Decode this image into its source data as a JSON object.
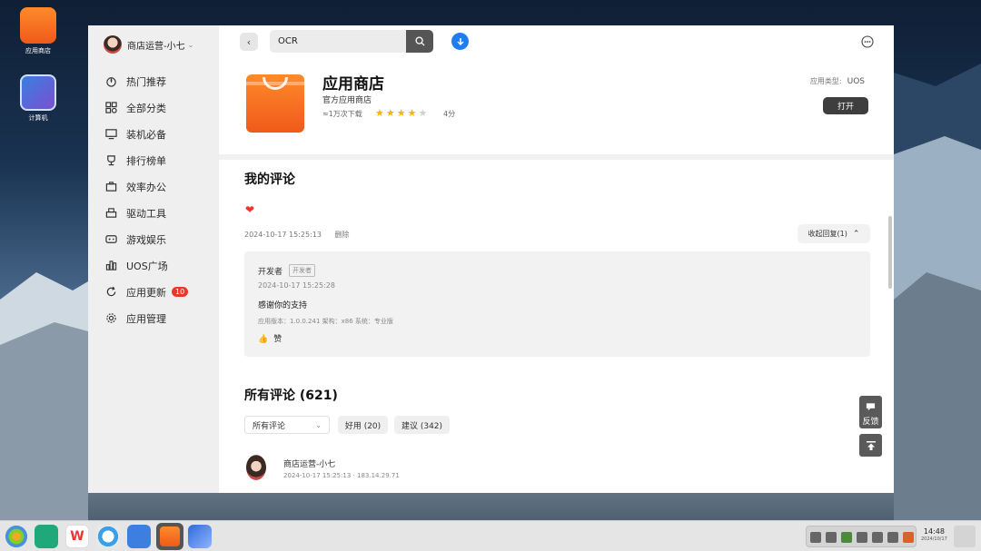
{
  "desktop": {
    "icons": [
      {
        "label": "应用商店",
        "icon": "app-store-icon"
      },
      {
        "label": "计算机",
        "icon": "computer-icon"
      }
    ]
  },
  "sidebar": {
    "user": {
      "name": "商店运营-小七",
      "icon": "user-avatar",
      "caret": "⌄"
    },
    "items": [
      {
        "label": "热门推荐",
        "icon": "fire-icon"
      },
      {
        "label": "全部分类",
        "icon": "grid-icon"
      },
      {
        "label": "装机必备",
        "icon": "monitor-icon"
      },
      {
        "label": "排行榜单",
        "icon": "trophy-icon"
      },
      {
        "label": "效率办公",
        "icon": "briefcase-icon"
      },
      {
        "label": "驱动工具",
        "icon": "printer-icon"
      },
      {
        "label": "游戏娱乐",
        "icon": "gamepad-icon"
      },
      {
        "label": "UOS广场",
        "icon": "chart-icon"
      },
      {
        "label": "应用更新",
        "icon": "refresh-icon",
        "badge": "10"
      },
      {
        "label": "应用管理",
        "icon": "gear-icon"
      }
    ]
  },
  "titlebar": {
    "search": {
      "value": "OCR",
      "icon": "search-icon"
    },
    "back_icon": "back-icon",
    "download_icon": "download-icon",
    "controls": [
      "more-icon",
      "minimize-icon",
      "maximize-icon",
      "close-icon"
    ]
  },
  "app": {
    "name": "应用商店",
    "subtitle": "官方应用商店",
    "downloads": "≈1万次下载",
    "rating_stars": 4,
    "rating_max": 5,
    "score": "4分",
    "type_label": "应用类型:",
    "type_value": "UOS",
    "open_label": "打开"
  },
  "my_review": {
    "title": "我的评论",
    "content_icon": "heart-icon",
    "time": "2024-10-17 15:25:13",
    "delete_label": "删除",
    "collapse_label": "收起回复(1)",
    "reply": {
      "author": "开发者",
      "tag": "开发者",
      "time": "2024-10-17 15:25:28",
      "text": "感谢你的支持",
      "info": "应用版本：1.0.0.241   架构：x86   系统：专业版",
      "like_label": "赞"
    }
  },
  "all_reviews": {
    "title": "所有评论 (621)",
    "filter_value": "所有评论",
    "chips": [
      "好用 (20)",
      "建议 (342)"
    ],
    "first": {
      "user": "商店运营-小七",
      "meta": "2024-10-17 15:25:13 · 183.14.29.71"
    }
  },
  "floating": {
    "feedback_label": "反馈",
    "feedback_icon": "message-icon",
    "top_icon": "arrow-up-icon"
  },
  "taskbar": {
    "apps": [
      "launcher-icon",
      "files-icon",
      "wps-icon",
      "browser-icon",
      "store-mini-icon",
      "app-store-icon",
      "screenshot-icon"
    ],
    "clock": {
      "time": "14:48",
      "date": "2024/10/17"
    }
  },
  "colors": {
    "accent": "#1e7ef0",
    "badge": "#e8382c",
    "star": "#f7b500",
    "app_orange": "#ef5a1a"
  }
}
